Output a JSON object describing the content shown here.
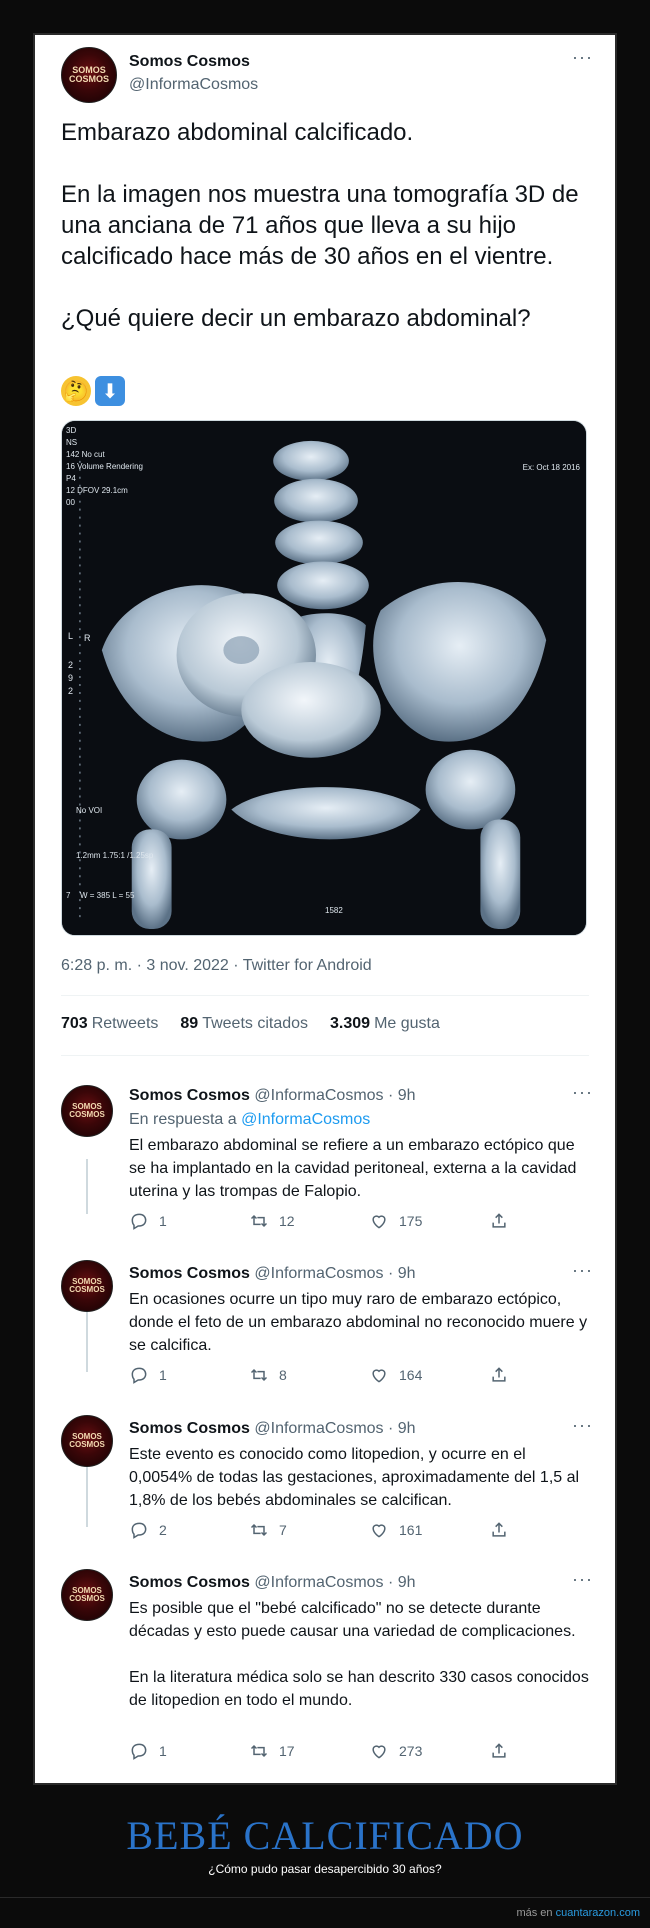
{
  "main_tweet": {
    "avatar_text": "SOMOS COSMOS",
    "name": "Somos Cosmos",
    "handle": "@InformaCosmos",
    "more": "···",
    "text": "Embarazo abdominal calcificado.\n\nEn la imagen nos muestra una tomografía 3D de una anciana de 71 años que lleva a su hijo calcificado hace más de 30 años en el vientre.\n\n¿Qué quiere decir un embarazo abdominal?",
    "emojis": [
      "🤔",
      "⬇"
    ],
    "image_labels": {
      "tl1": "3D",
      "tl2": "NS",
      "tl3": "142",
      "tl4": "No cut",
      "tl5": "16",
      "tl6": "Volume Rendering",
      "tl7": "P4",
      "tl8": "12",
      "tl9": "DFOV 29.1cm",
      "tl10": "00",
      "date": "Ex: Oct 18 2016",
      "r_left": "L",
      "r_mid": "R",
      "n1": "2",
      "n2": "9",
      "n3": "2",
      "novoi": "No VOI",
      "thick": "1.2mm 1.75:1 /1.25sp",
      "wl": "W = 385 L = 55",
      "num": "1582",
      "seven": "7"
    },
    "meta": "6:28 p. m. · 3 nov. 2022 · Twitter for Android",
    "stats": [
      {
        "value": "703",
        "label": "Retweets"
      },
      {
        "value": "89",
        "label": "Tweets citados"
      },
      {
        "value": "3.309",
        "label": "Me gusta"
      }
    ]
  },
  "replies": [
    {
      "name": "Somos Cosmos",
      "handle": "@InformaCosmos",
      "time": "9h",
      "reply_to_prefix": "En respuesta a",
      "reply_to_handle": "@InformaCosmos",
      "text": "El embarazo abdominal se refiere a un embarazo ectópico que se ha implantado en la cavidad peritoneal, externa a la cavidad uterina y las trompas de Falopio.",
      "replies": "1",
      "retweets": "12",
      "likes": "175"
    },
    {
      "name": "Somos Cosmos",
      "handle": "@InformaCosmos",
      "time": "9h",
      "text": "En ocasiones ocurre un tipo muy raro de embarazo ectópico, donde el feto de un embarazo abdominal no reconocido muere y se calcifica.",
      "replies": "1",
      "retweets": "8",
      "likes": "164"
    },
    {
      "name": "Somos Cosmos",
      "handle": "@InformaCosmos",
      "time": "9h",
      "text": "Este evento es conocido como litopedion, y ocurre en el 0,0054% de todas las gestaciones, aproximadamente del 1,5 al 1,8% de los bebés abdominales se calcifican.",
      "replies": "2",
      "retweets": "7",
      "likes": "161"
    },
    {
      "name": "Somos Cosmos",
      "handle": "@InformaCosmos",
      "time": "9h",
      "text": "Es posible que el \"bebé calcificado\" no se detecte durante décadas y esto puede causar una variedad de complicaciones.\n\nEn la literatura médica solo se han descrito 330 casos conocidos de litopedion en todo el mundo.",
      "replies": "1",
      "retweets": "17",
      "likes": "273"
    }
  ],
  "caption": {
    "title": "BEBÉ CALCIFICADO",
    "subtitle": "¿Cómo pudo pasar desapercibido 30 años?"
  },
  "footer": {
    "prefix": "más en",
    "site": "cuantarazon.com"
  },
  "colors": {
    "accent": "#1d9bf0",
    "caption_title": "#2a73c9",
    "muted": "#536471"
  }
}
